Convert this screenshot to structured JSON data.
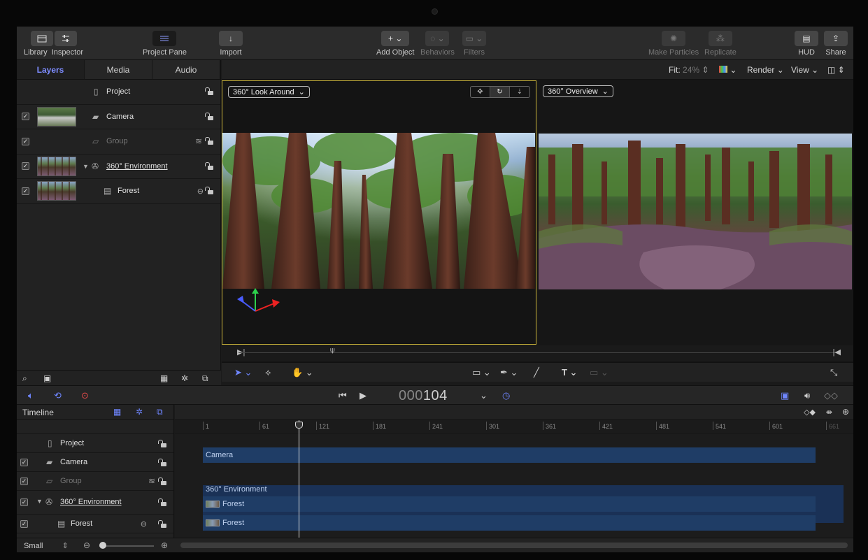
{
  "toolbar": {
    "library": "Library",
    "inspector": "Inspector",
    "project_pane": "Project Pane",
    "import": "Import",
    "add_object": "Add Object",
    "behaviors": "Behaviors",
    "filters": "Filters",
    "make_particles": "Make Particles",
    "replicate": "Replicate",
    "hud": "HUD",
    "share": "Share"
  },
  "tabs": [
    "Layers",
    "Media",
    "Audio"
  ],
  "layers": [
    {
      "name": "Project"
    },
    {
      "name": "Camera"
    },
    {
      "name": "Group"
    },
    {
      "name": "360° Environment"
    },
    {
      "name": "Forest"
    }
  ],
  "viewer_bar": {
    "fit_label": "Fit:",
    "fit_value": "24%",
    "render": "Render",
    "view": "View"
  },
  "viewers": {
    "left_popup": "360° Look Around",
    "right_popup": "360° Overview"
  },
  "transport": {
    "timecode_dim": "000",
    "timecode_value": "104"
  },
  "timeline": {
    "title": "Timeline",
    "ruler": [
      "1",
      "61",
      "121",
      "181",
      "241",
      "301",
      "361",
      "421",
      "481",
      "541",
      "601",
      "661"
    ],
    "tracks": {
      "camera": "Camera",
      "environment": "360° Environment",
      "forest_1": "Forest",
      "forest_2": "Forest"
    },
    "zoom_label": "Small"
  },
  "colors": {
    "accent": "#7d8cff",
    "selection_border": "#c8b23a",
    "track": "#1f3d66"
  }
}
